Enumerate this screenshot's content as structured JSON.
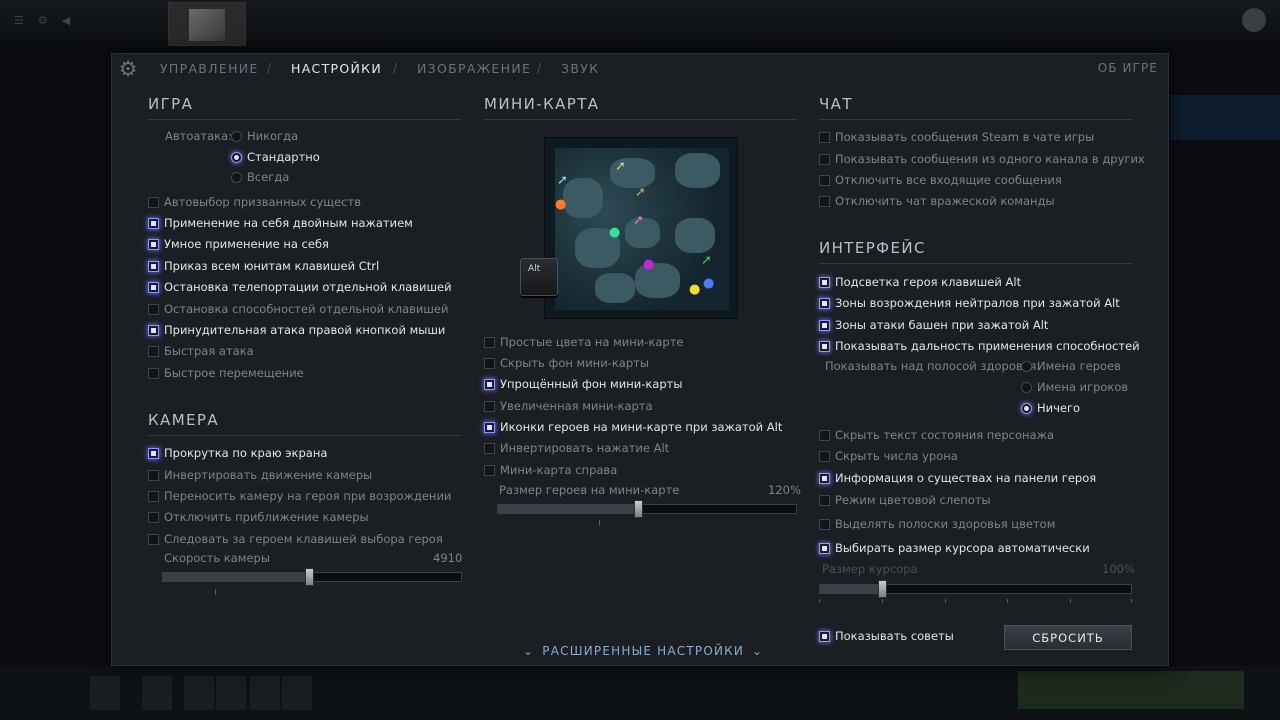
{
  "tabs": {
    "controls": "УПРАВЛЕНИЕ",
    "settings": "НАСТРОЙКИ",
    "image": "ИЗОБРАЖЕНИЕ",
    "sound": "ЗВУК",
    "sep": "/",
    "about": "ОБ ИГРЕ"
  },
  "game": {
    "title": "ИГРА",
    "autoattack_label": "Автоатака:",
    "autoattack_options": [
      "Никогда",
      "Стандартно",
      "Всегда"
    ],
    "autoattack_selected": "Стандартно",
    "options": [
      {
        "label": "Автовыбор призванных существ",
        "checked": false
      },
      {
        "label": "Применение на себя двойным нажатием",
        "checked": true
      },
      {
        "label": "Умное применение на себя",
        "checked": true
      },
      {
        "label": "Приказ всем юнитам клавишей Ctrl",
        "checked": true
      },
      {
        "label": "Остановка телепортации отдельной клавишей",
        "checked": true
      },
      {
        "label": "Остановка способностей отдельной клавишей",
        "checked": false
      },
      {
        "label": "Принудительная атака правой кнопкой мыши",
        "checked": true
      },
      {
        "label": "Быстрая атака",
        "checked": false
      },
      {
        "label": "Быстрое перемещение",
        "checked": false
      }
    ]
  },
  "camera": {
    "title": "КАМЕРА",
    "options": [
      {
        "label": "Прокрутка по краю экрана",
        "checked": true
      },
      {
        "label": "Инвертировать движение камеры",
        "checked": false
      },
      {
        "label": "Переносить камеру на героя при возрождении",
        "checked": false
      },
      {
        "label": "Отключить приближение камеры",
        "checked": false
      },
      {
        "label": "Следовать за героем клавишей выбора героя",
        "checked": false
      }
    ],
    "speed_label": "Скорость камеры",
    "speed_value": "4910",
    "speed_fraction": 0.49
  },
  "minimap": {
    "title": "МИНИ-КАРТА",
    "alt_key": "Alt",
    "options": [
      {
        "label": "Простые цвета на мини-карте",
        "checked": false
      },
      {
        "label": "Скрыть фон мини-карты",
        "checked": false
      },
      {
        "label": "Упрощённый фон мини-карты",
        "checked": true
      },
      {
        "label": "Увеличенная мини-карта",
        "checked": false
      },
      {
        "label": "Иконки героев на мини-карте при зажатой Alt",
        "checked": true
      },
      {
        "label": "Инвертировать нажатие Alt",
        "checked": false
      },
      {
        "label": "Мини-карта справа",
        "checked": false
      }
    ],
    "hero_size_label": "Размер героев на мини-карте",
    "hero_size_value": "120%",
    "hero_size_fraction": 0.47
  },
  "chat": {
    "title": "ЧАТ",
    "options": [
      {
        "label": "Показывать сообщения Steam в чате игры",
        "checked": false
      },
      {
        "label": "Показывать сообщения из одного канала в других",
        "checked": false
      },
      {
        "label": "Отключить все входящие сообщения",
        "checked": false
      },
      {
        "label": "Отключить чат вражеской команды",
        "checked": false
      }
    ]
  },
  "interface": {
    "title": "ИНТЕРФЕЙС",
    "options_top": [
      {
        "label": "Подсветка героя клавишей Alt",
        "checked": true
      },
      {
        "label": "Зоны возрождения нейтралов при зажатой Alt",
        "checked": true
      },
      {
        "label": "Зоны атаки башен при зажатой Alt",
        "checked": true
      },
      {
        "label": "Показывать дальность применения способностей",
        "checked": true
      }
    ],
    "healthbar_label": "Показывать над полосой здоровья:",
    "healthbar_options": [
      "Имена героев",
      "Имена игроков",
      "Ничего"
    ],
    "healthbar_selected": "Ничего",
    "options_bottom": [
      {
        "label": "Скрыть текст состояния персонажа",
        "checked": false
      },
      {
        "label": "Скрыть числа урона",
        "checked": false
      },
      {
        "label": "Информация о существах на панели героя",
        "checked": true
      },
      {
        "label": "Режим цветовой слепоты",
        "checked": false
      },
      {
        "label": "Выделять полоски здоровья цветом",
        "checked": false
      },
      {
        "label": "Выбирать размер курсора автоматически",
        "checked": true
      }
    ],
    "cursor_size_label": "Размер курсора",
    "cursor_size_value": "100%",
    "cursor_size_fraction": 0.2,
    "show_tips_label": "Показывать советы",
    "show_tips_checked": true,
    "reset_label": "СБРОСИТЬ"
  },
  "advanced_label": "РАСШИРЕННЫЕ НАСТРОЙКИ",
  "colors": {
    "panel_bg": "#1b1e22",
    "accent_glow": "#8e99ff",
    "text_active": "#e3e6e9",
    "text_inactive": "#7d858c"
  }
}
